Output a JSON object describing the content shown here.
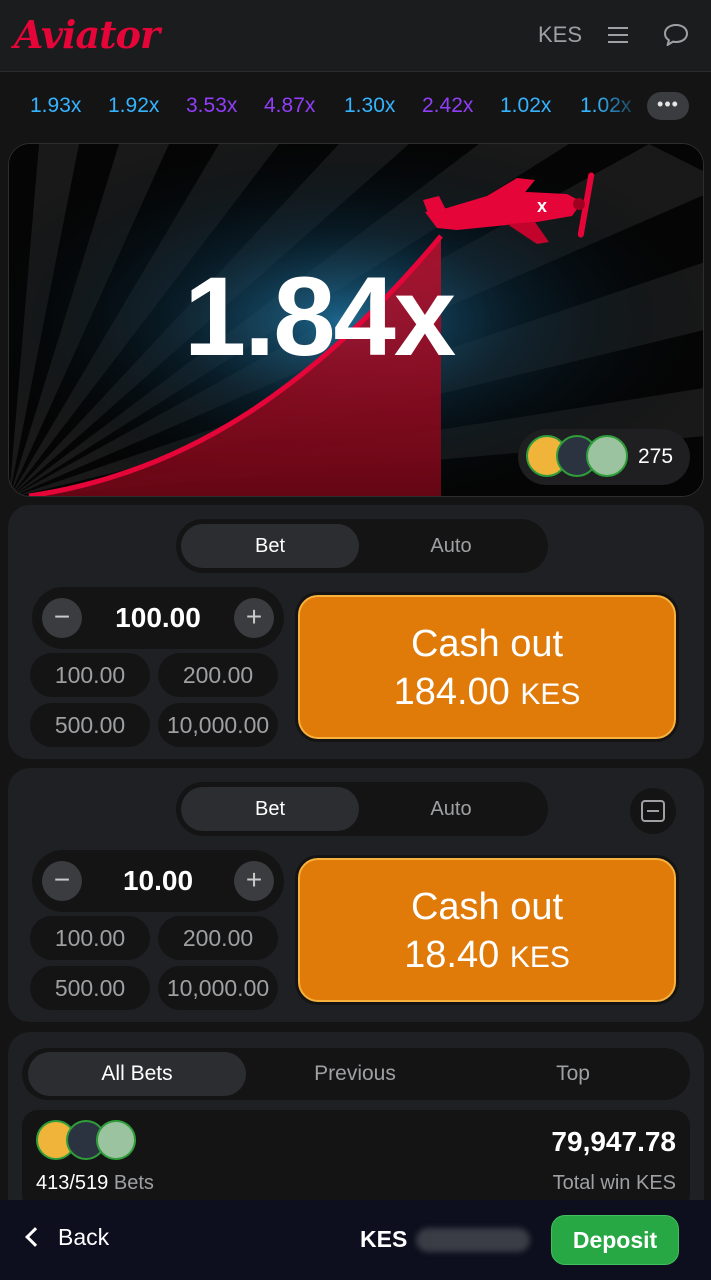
{
  "header": {
    "logo_text": "Aviator",
    "currency": "KES",
    "menu_icon": "hamburger-menu-icon",
    "chat_icon": "chat-bubble-icon"
  },
  "history": {
    "items": [
      {
        "value": "1.93x",
        "color": "#34b4ff"
      },
      {
        "value": "1.92x",
        "color": "#34b4ff"
      },
      {
        "value": "3.53x",
        "color": "#913ef8"
      },
      {
        "value": "4.87x",
        "color": "#913ef8"
      },
      {
        "value": "1.30x",
        "color": "#34b4ff"
      },
      {
        "value": "2.42x",
        "color": "#913ef8"
      },
      {
        "value": "1.02x",
        "color": "#34b4ff"
      },
      {
        "value": "1.02x",
        "color": "#34b4ff"
      }
    ],
    "more_label": "•••"
  },
  "game": {
    "multiplier": "1.84x",
    "players_count": "275",
    "accent_color": "#e50539"
  },
  "bet_panels": [
    {
      "tabs": [
        "Bet",
        "Auto"
      ],
      "active_tab": "Bet",
      "stake": "100.00",
      "quick_amounts": [
        "100.00",
        "200.00",
        "500.00",
        "10,000.00"
      ],
      "cashout_label": "Cash out",
      "cashout_amount": "184.00",
      "cashout_currency": "KES"
    },
    {
      "tabs": [
        "Bet",
        "Auto"
      ],
      "active_tab": "Bet",
      "stake": "10.00",
      "quick_amounts": [
        "100.00",
        "200.00",
        "500.00",
        "10,000.00"
      ],
      "cashout_label": "Cash out",
      "cashout_amount": "18.40",
      "cashout_currency": "KES"
    }
  ],
  "bets_list": {
    "tabs": [
      "All Bets",
      "Previous",
      "Top"
    ],
    "active_tab": "All Bets",
    "bets_count": "413/519",
    "bets_label": "Bets",
    "total_win": "79,947.78",
    "total_win_label": "Total win KES"
  },
  "footer": {
    "back_label": "Back",
    "currency": "KES",
    "deposit_label": "Deposit"
  },
  "colors": {
    "cashout_orange": "#e07a09",
    "deposit_green": "#28a745",
    "low_multiplier_blue": "#34b4ff",
    "mid_multiplier_purple": "#913ef8"
  }
}
